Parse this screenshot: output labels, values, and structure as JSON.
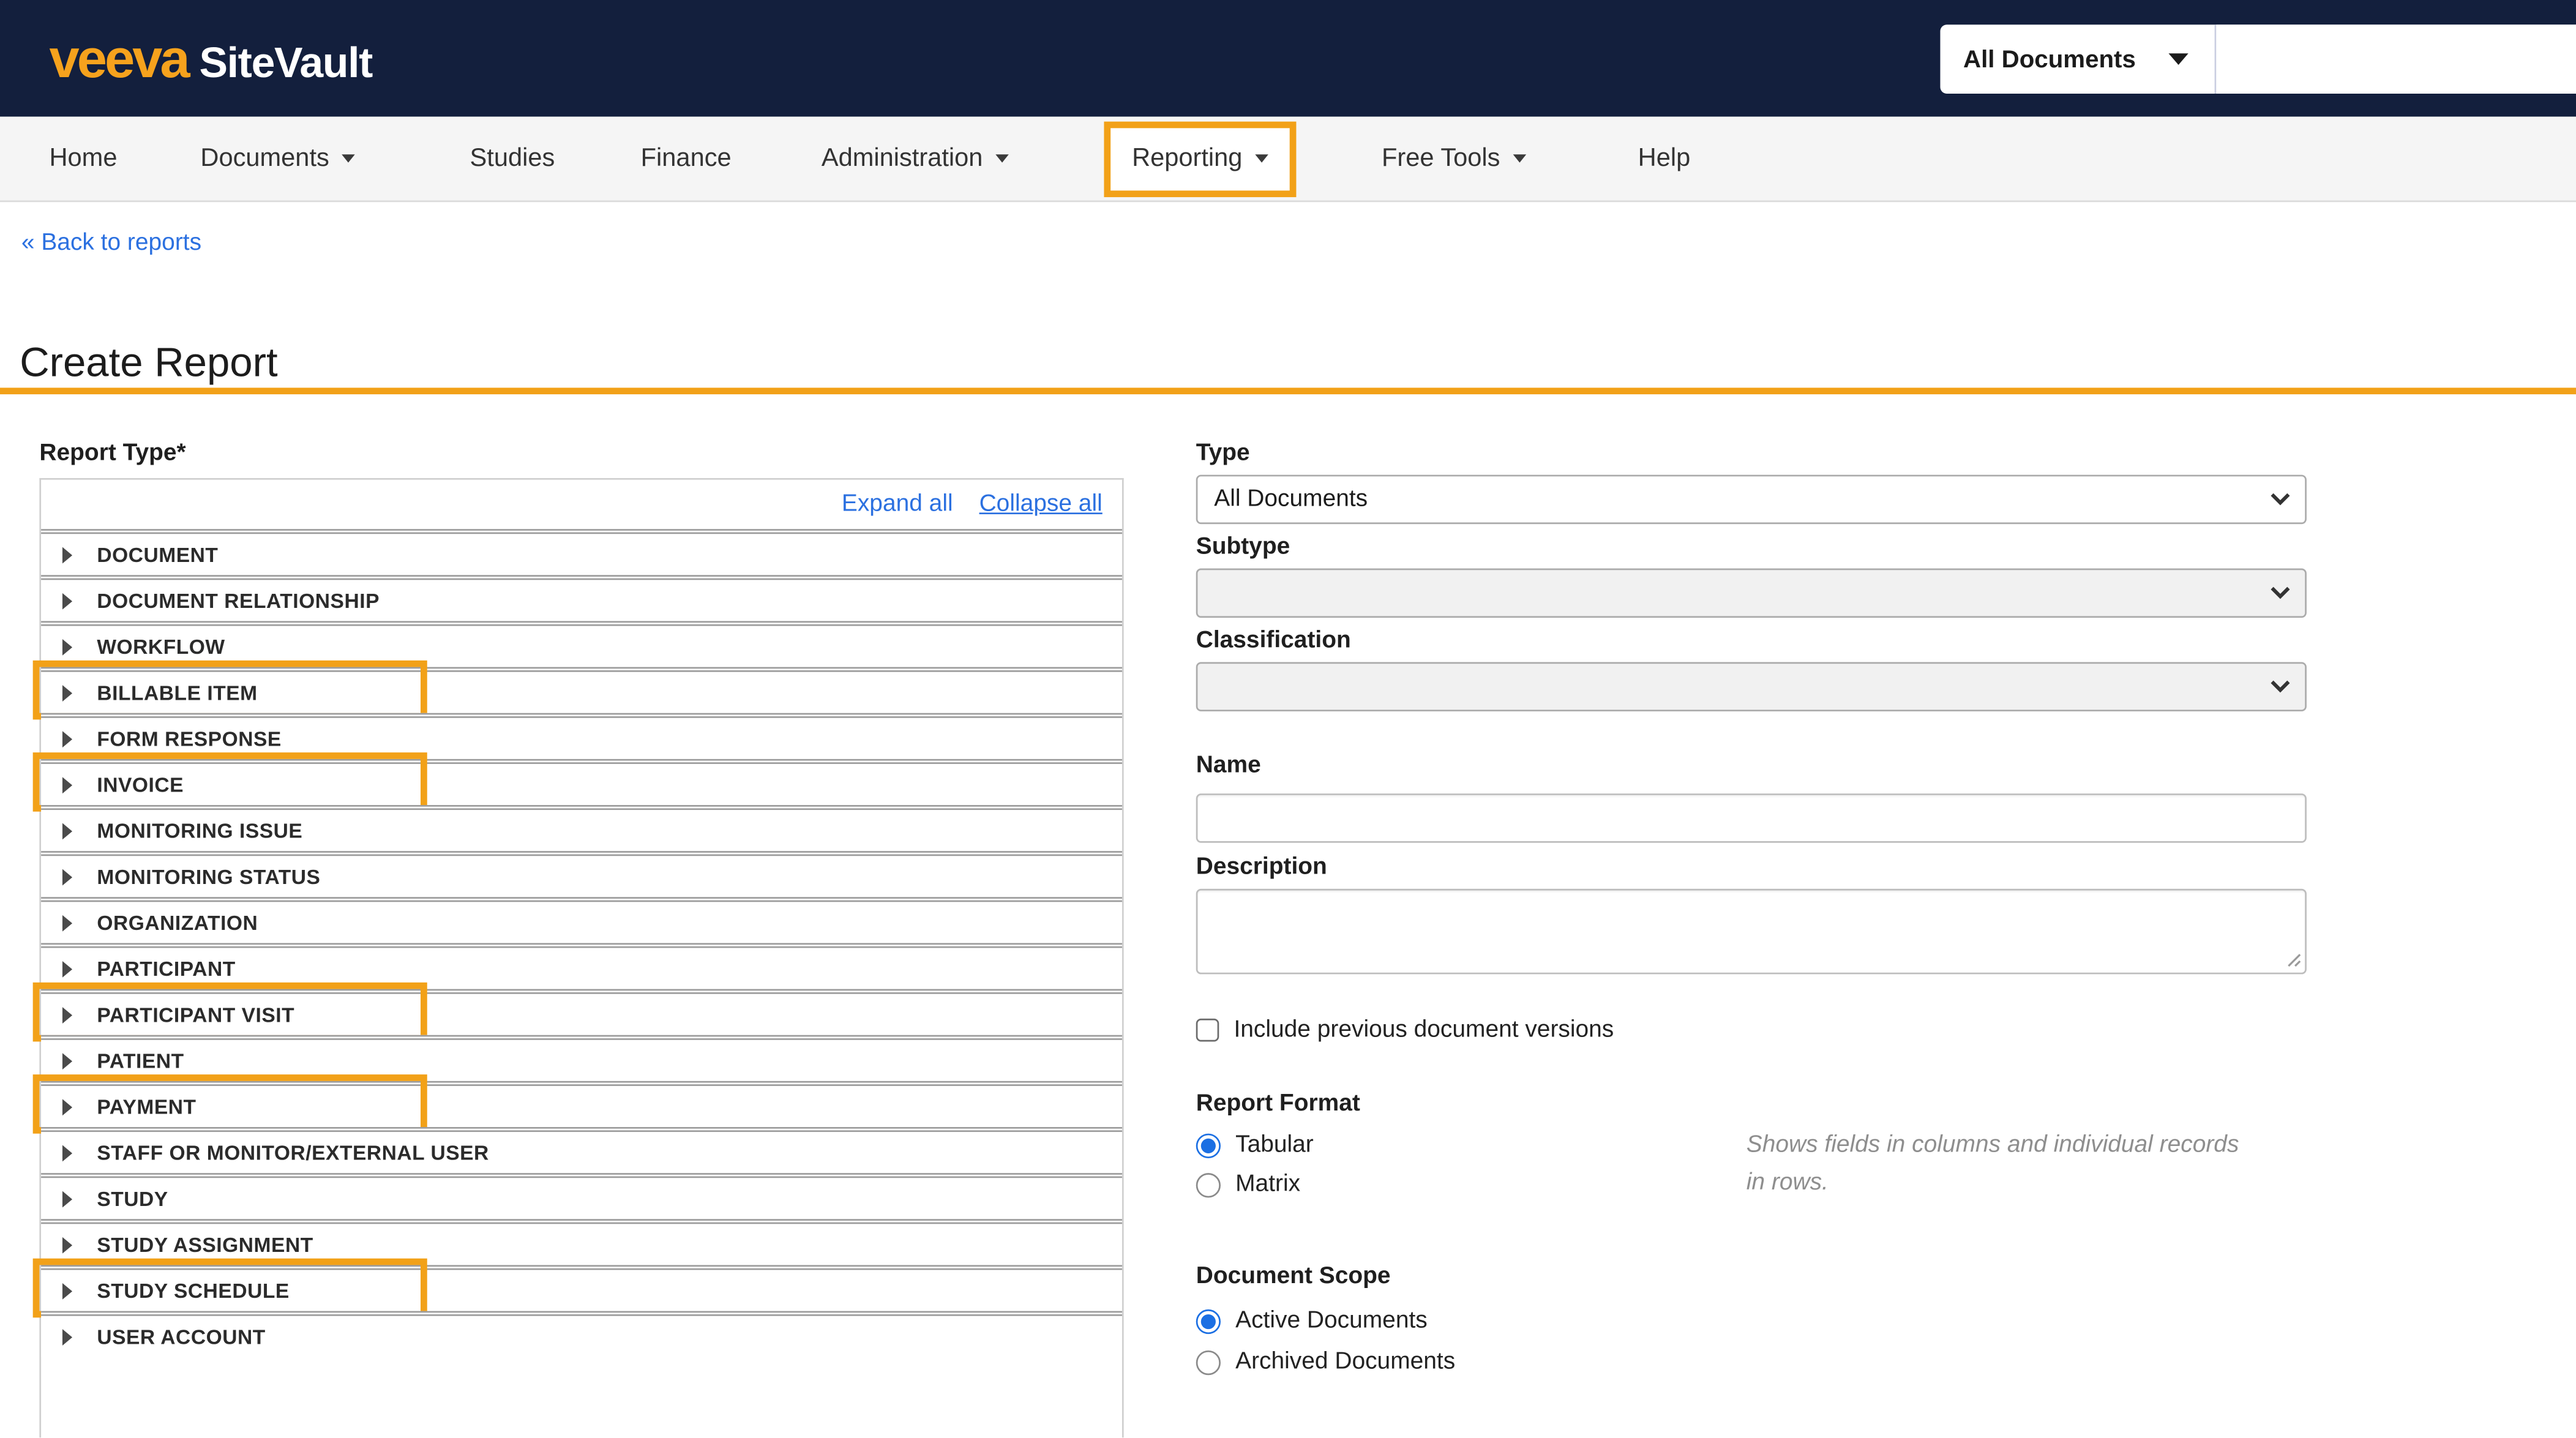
{
  "colors": {
    "header_navy": "#131F3D",
    "accent_orange": "#F2A118",
    "link_blue": "#2B70E0",
    "radio_blue": "#1B6FE3",
    "navbar_gray": "#F5F5F5"
  },
  "brand": {
    "logo_veeva": "veeva",
    "logo_product": "SiteVault"
  },
  "topbar": {
    "scope_value": "All Documents",
    "search_value": ""
  },
  "nav": {
    "items": [
      {
        "label": "Home",
        "caret": false,
        "highlighted": false
      },
      {
        "label": "Documents",
        "caret": true,
        "highlighted": false
      },
      {
        "label": "Studies",
        "caret": false,
        "highlighted": false
      },
      {
        "label": "Finance",
        "caret": false,
        "highlighted": false
      },
      {
        "label": "Administration",
        "caret": true,
        "highlighted": false
      },
      {
        "label": "Reporting",
        "caret": true,
        "highlighted": true
      },
      {
        "label": "Free Tools",
        "caret": true,
        "highlighted": false
      },
      {
        "label": "Help",
        "caret": false,
        "highlighted": false
      }
    ]
  },
  "breadcrumb": {
    "back_link": "« Back to reports"
  },
  "page": {
    "title": "Create Report"
  },
  "report_type_panel": {
    "label": "Report Type*",
    "expand_all": "Expand all",
    "collapse_all": "Collapse all",
    "items": [
      {
        "label": "DOCUMENT",
        "highlighted": false
      },
      {
        "label": "DOCUMENT RELATIONSHIP",
        "highlighted": false
      },
      {
        "label": "WORKFLOW",
        "highlighted": false
      },
      {
        "label": "BILLABLE ITEM",
        "highlighted": true
      },
      {
        "label": "FORM RESPONSE",
        "highlighted": false
      },
      {
        "label": "INVOICE",
        "highlighted": true
      },
      {
        "label": "MONITORING ISSUE",
        "highlighted": false
      },
      {
        "label": "MONITORING STATUS",
        "highlighted": false
      },
      {
        "label": "ORGANIZATION",
        "highlighted": false
      },
      {
        "label": "PARTICIPANT",
        "highlighted": false
      },
      {
        "label": "PARTICIPANT VISIT",
        "highlighted": true
      },
      {
        "label": "PATIENT",
        "highlighted": false
      },
      {
        "label": "PAYMENT",
        "highlighted": true
      },
      {
        "label": "STAFF OR MONITOR/EXTERNAL USER",
        "highlighted": false
      },
      {
        "label": "STUDY",
        "highlighted": false
      },
      {
        "label": "STUDY ASSIGNMENT",
        "highlighted": false
      },
      {
        "label": "STUDY SCHEDULE",
        "highlighted": true
      },
      {
        "label": "USER ACCOUNT",
        "highlighted": false
      }
    ]
  },
  "form": {
    "type": {
      "label": "Type",
      "value": "All Documents",
      "disabled": false
    },
    "subtype": {
      "label": "Subtype",
      "value": "",
      "disabled": true
    },
    "classification": {
      "label": "Classification",
      "value": "",
      "disabled": true
    },
    "name": {
      "label": "Name",
      "value": ""
    },
    "description": {
      "label": "Description",
      "value": ""
    },
    "include_previous": {
      "label": "Include previous document versions",
      "checked": false
    },
    "report_format": {
      "label": "Report Format",
      "options": [
        {
          "label": "Tabular",
          "selected": true
        },
        {
          "label": "Matrix",
          "selected": false
        }
      ],
      "note": "Shows fields in columns and individual records in rows."
    },
    "document_scope": {
      "label": "Document Scope",
      "options": [
        {
          "label": "Active Documents",
          "selected": true
        },
        {
          "label": "Archived Documents",
          "selected": false
        }
      ]
    }
  }
}
